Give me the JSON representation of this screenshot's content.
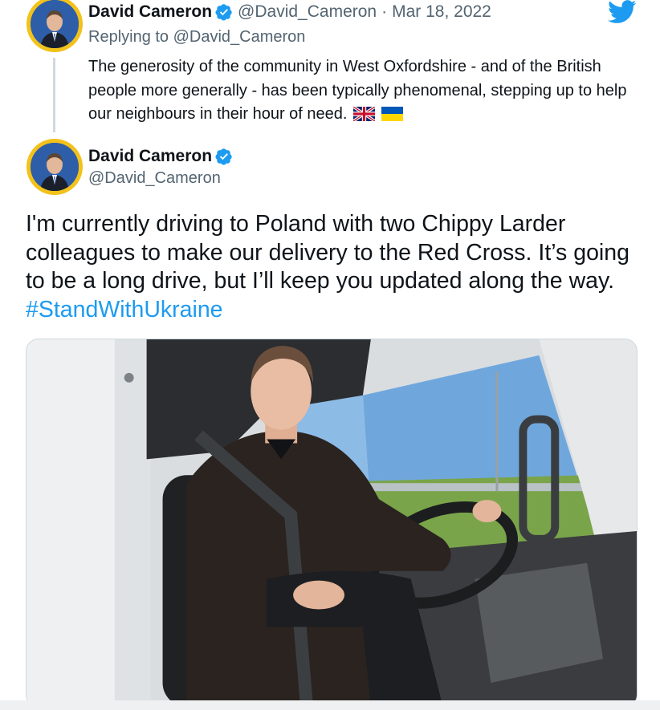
{
  "reply_tweet": {
    "author_name": "David Cameron",
    "handle": "@David_Cameron",
    "separator": "·",
    "date": "Mar 18, 2022",
    "replying_to": "Replying to @David_Cameron",
    "text": "The generosity of the community in West Oxfordshire - and of the British people more generally - has been typically phenomenal, stepping up to help our neighbours in their hour of need.",
    "flags": [
      "united-kingdom-flag",
      "ukraine-flag"
    ]
  },
  "main_tweet": {
    "author_name": "David Cameron",
    "handle": "@David_Cameron",
    "text": "I'm currently driving to Poland with two Chippy Larder colleagues to make our delivery to the Red Cross. It’s going to be a long drive, but I’ll keep you updated along the way. ",
    "hashtag": "#StandWithUkraine",
    "media": "photo of man seated in driver's seat of a white van cab"
  },
  "icons": {
    "verified": "verified-badge-icon",
    "brand": "twitter-bird-icon"
  },
  "colors": {
    "link": "#1d9bf0",
    "verified": "#1d9bf0",
    "secondary_text": "#536471",
    "avatar_ring": "#f2c21b",
    "avatar_fill": "#1e4f9c"
  }
}
